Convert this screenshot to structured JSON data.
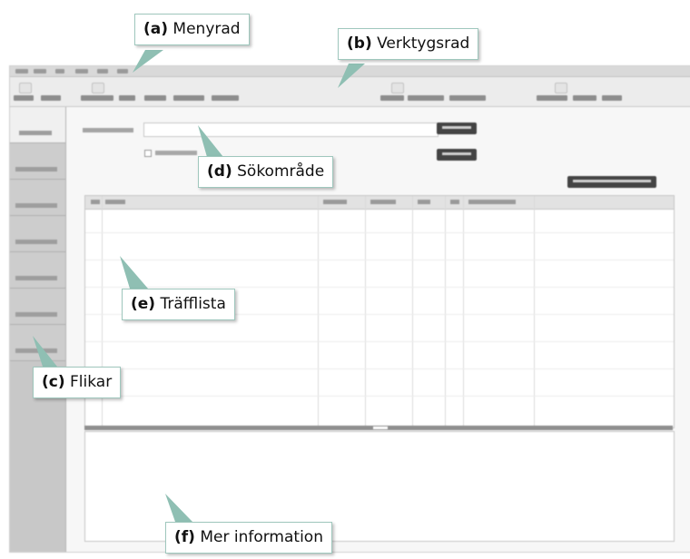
{
  "annotations": {
    "menubar": {
      "letter": "(a)",
      "text": " Menyrad"
    },
    "toolbar": {
      "letter": "(b)",
      "text": " Verktygsrad"
    },
    "tabs": {
      "letter": "(c)",
      "text": " Flikar"
    },
    "search_area": {
      "letter": "(d)",
      "text": " Sökområde"
    },
    "hit_list": {
      "letter": "(e)",
      "text": " Träfflista"
    },
    "more_info": {
      "letter": "(f)",
      "text": " Mer information"
    }
  },
  "colors": {
    "callout_border": "#9fc7bd",
    "pointer": "#8fbfb3",
    "dark_button": "#444444"
  }
}
